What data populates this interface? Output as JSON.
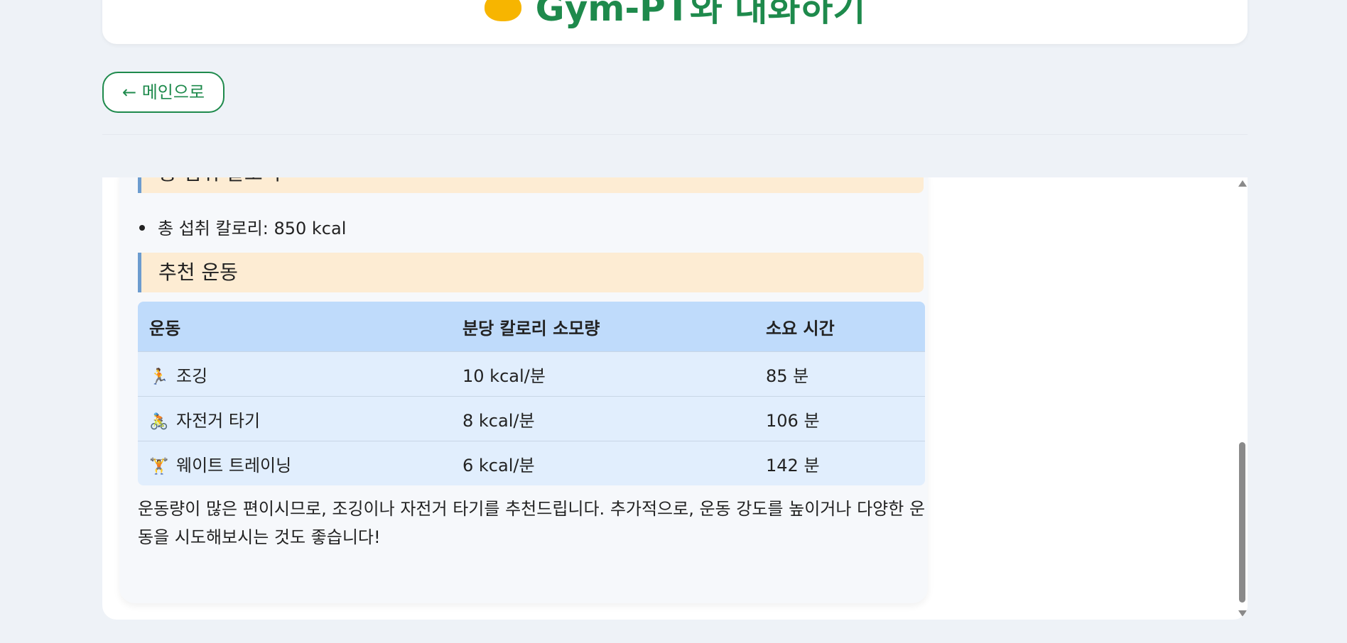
{
  "header": {
    "title": "Gym-PT와 대화하기",
    "emoji_icon": "flexed-biceps-icon",
    "accent_color": "#1e8a4c"
  },
  "nav": {
    "back_label": "← 메인으로"
  },
  "message": {
    "calorie_heading": "총 섭취 칼로리",
    "calorie_item": "총 섭취 칼로리: 850 kcal",
    "exercise_heading": "추천 운동",
    "table": {
      "headers": [
        "운동",
        "분당 칼로리 소모량",
        "소요 시간"
      ],
      "rows": [
        {
          "icon": "running-person-icon",
          "glyph": "🏃",
          "name": "조깅",
          "rate": "10 kcal/분",
          "time": "85 분"
        },
        {
          "icon": "biking-person-icon",
          "glyph": "🚴",
          "name": "자전거 타기",
          "rate": "8 kcal/분",
          "time": "106 분"
        },
        {
          "icon": "weightlifter-icon",
          "glyph": "🏋",
          "name": "웨이트 트레이닝",
          "rate": "6 kcal/분",
          "time": "142 분"
        }
      ]
    },
    "summary": "운동량이 많은 편이시므로, 조깅이나 자전거 타기를 추천드립니다. 추가적으로, 운동 강도를 높이거나 다양한 운동을 시도해보시는 것도 좋습니다!"
  }
}
